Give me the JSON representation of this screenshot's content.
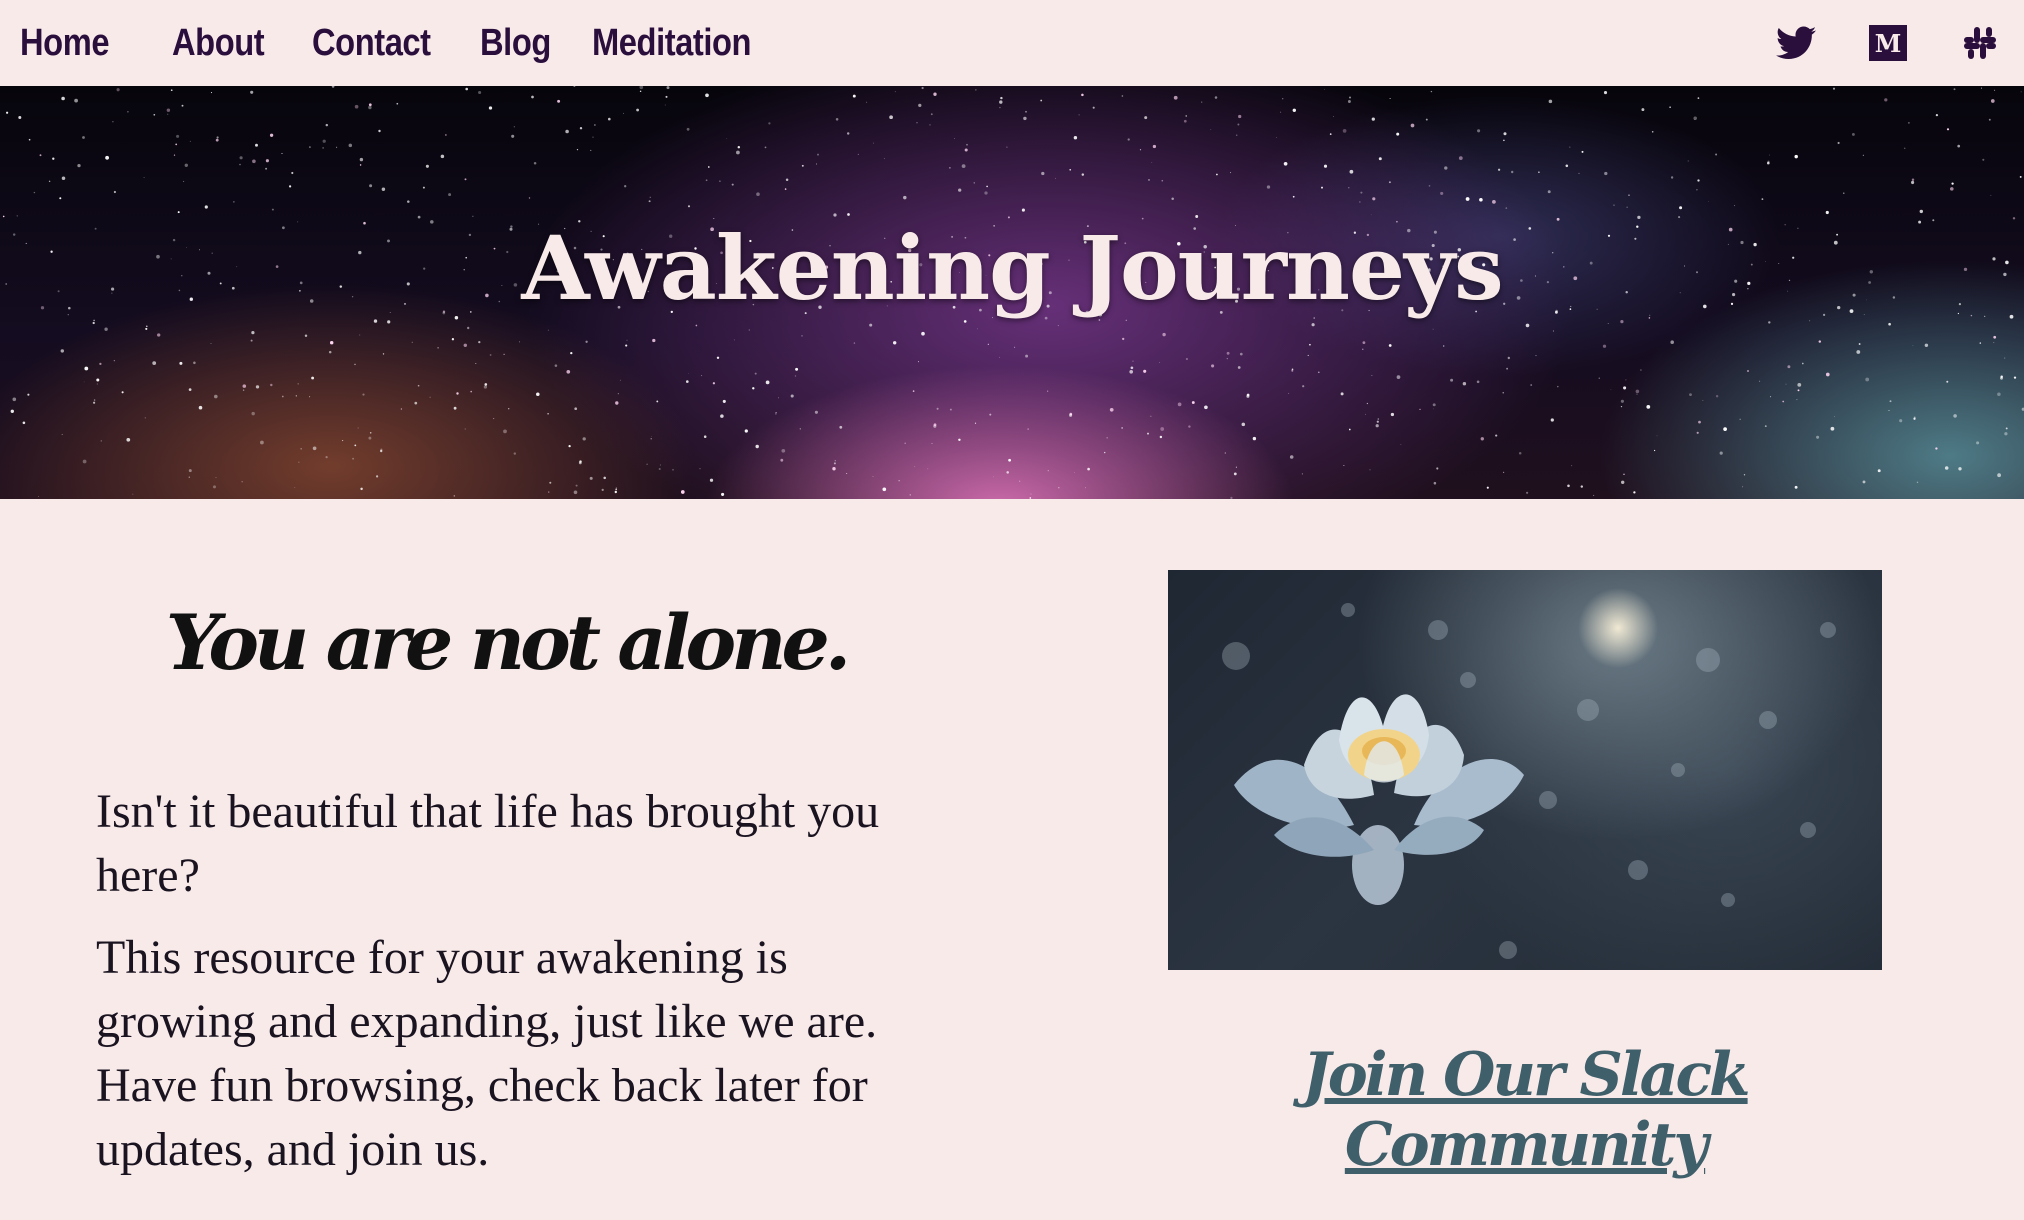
{
  "nav": {
    "links": [
      "Home",
      "About",
      "Contact",
      "Blog",
      "Meditation"
    ],
    "icons": [
      "twitter-icon",
      "medium-icon",
      "slack-icon"
    ],
    "medium_glyph": "M",
    "color": "#2a0f3d"
  },
  "hero": {
    "title": "Awakening Journeys"
  },
  "main": {
    "tagline": "You are not alone.",
    "paragraphs": [
      "Isn't it beautiful that life has brought you here?",
      "This resource for your awakening is growing and expanding, just like we are. Have fun browsing, check back later for updates, and join us."
    ],
    "cta_label": "Join Our Slack Community"
  },
  "colors": {
    "background": "#f9eaea",
    "accent_link": "#3f5f6a",
    "text": "#1a1420"
  }
}
